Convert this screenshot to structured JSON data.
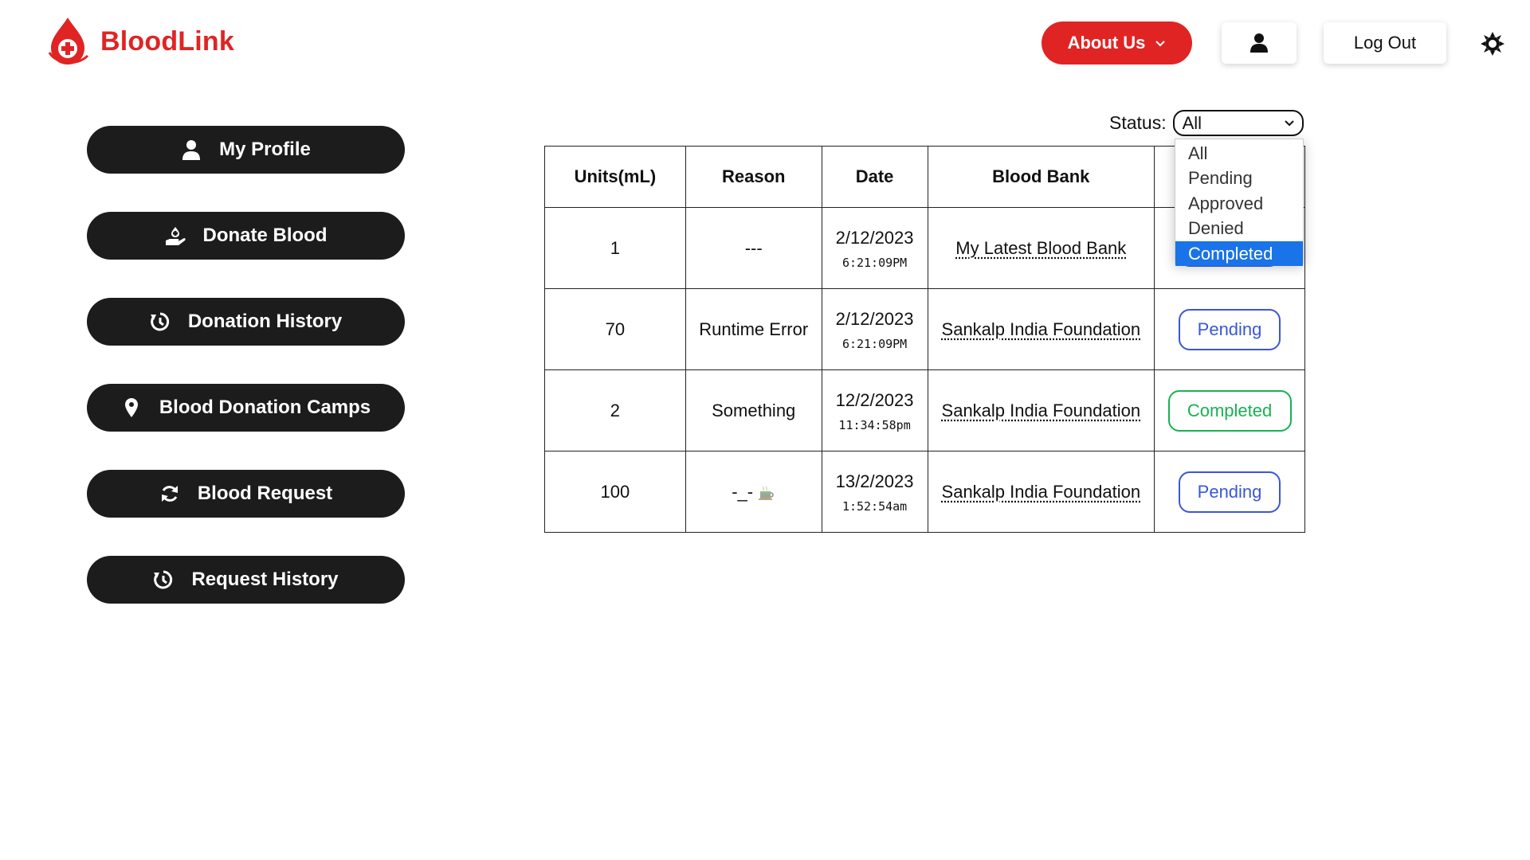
{
  "brand": {
    "name": "BloodLink"
  },
  "header": {
    "about_label": "About Us",
    "logout_label": "Log Out"
  },
  "sidebar": {
    "items": [
      {
        "label": "My Profile",
        "icon": "user-icon"
      },
      {
        "label": "Donate Blood",
        "icon": "donate-icon"
      },
      {
        "label": "Donation History",
        "icon": "history-icon"
      },
      {
        "label": "Blood Donation Camps",
        "icon": "location-pin-icon"
      },
      {
        "label": "Blood Request",
        "icon": "refresh-icon"
      },
      {
        "label": "Request History",
        "icon": "history-icon"
      }
    ]
  },
  "filter": {
    "label": "Status:",
    "selected": "All",
    "options": [
      "All",
      "Pending",
      "Approved",
      "Denied",
      "Completed"
    ],
    "highlighted": "Completed"
  },
  "table": {
    "headers": [
      "Units(mL)",
      "Reason",
      "Date",
      "Blood Bank"
    ],
    "rows": [
      {
        "units": "1",
        "reason": "---",
        "date": "2/12/2023",
        "time": "6:21:09PM",
        "bank": "My Latest Blood Bank",
        "status": ""
      },
      {
        "units": "70",
        "reason": "Runtime Error",
        "date": "2/12/2023",
        "time": "6:21:09PM",
        "bank": "Sankalp India Foundation",
        "status": "Pending"
      },
      {
        "units": "2",
        "reason": "Something",
        "date": "12/2/2023",
        "time": "11:34:58pm",
        "bank": "Sankalp India Foundation",
        "status": "Completed"
      },
      {
        "units": "100",
        "reason": "-_-",
        "date": "13/2/2023",
        "time": "1:52:54am",
        "bank": "Sankalp India Foundation",
        "status": "Pending"
      }
    ]
  },
  "colors": {
    "brand_red": "#e02424",
    "sidebar_dark": "#1c1c1c",
    "pending_blue": "#3a57d6",
    "completed_green": "#18b153",
    "select_highlight": "#1a73e8"
  }
}
